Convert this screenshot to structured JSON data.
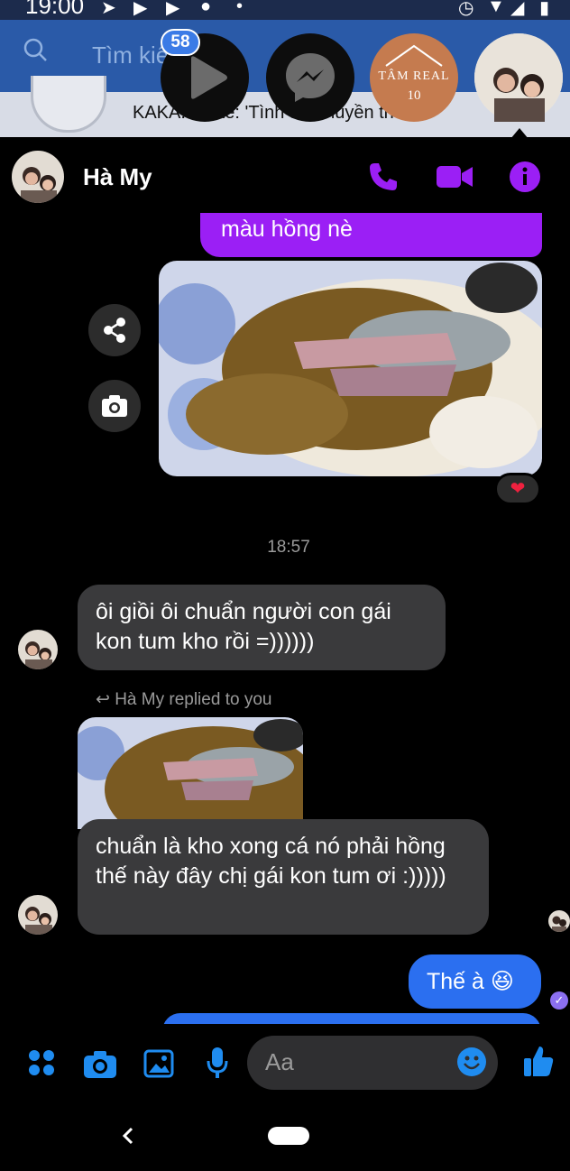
{
  "status_bar": {
    "time": "19:00"
  },
  "background_app": {
    "search_placeholder": "Tìm kiế",
    "news_text": "KAKA...aoke: 'Tình thơ 'huyền thoại..."
  },
  "chat_heads": {
    "badge_count": "58",
    "tamreal_line1": "TÂM REAL",
    "tamreal_line2": "10"
  },
  "header": {
    "contact_name": "Hà My"
  },
  "messages": {
    "purple_partial": "màu hồng nè",
    "timestamp": "18:57",
    "msg1": "ôi giồi ôi chuẩn người con gái kon tum kho rồi =))))))",
    "replied_label": "Hà My replied to you",
    "msg2": "chuẩn là kho xong cá nó phải hồng thế này đây chị gái kon tum ơi :)))))",
    "msg3": "Thế à 😆",
    "reaction": "❤"
  },
  "composer": {
    "placeholder": "Aa"
  },
  "colors": {
    "accent_purple": "#9b1ff5",
    "outgoing_blue": "#2b6ff0",
    "incoming_gray": "#3a3a3c",
    "icon_blue": "#1f8cf0"
  },
  "icons": {
    "header": [
      "phone-icon",
      "video-camera-icon",
      "info-icon"
    ],
    "composer": [
      "apps-icon",
      "camera-icon",
      "gallery-icon",
      "mic-icon",
      "emoji-icon",
      "thumbs-up-icon"
    ]
  }
}
